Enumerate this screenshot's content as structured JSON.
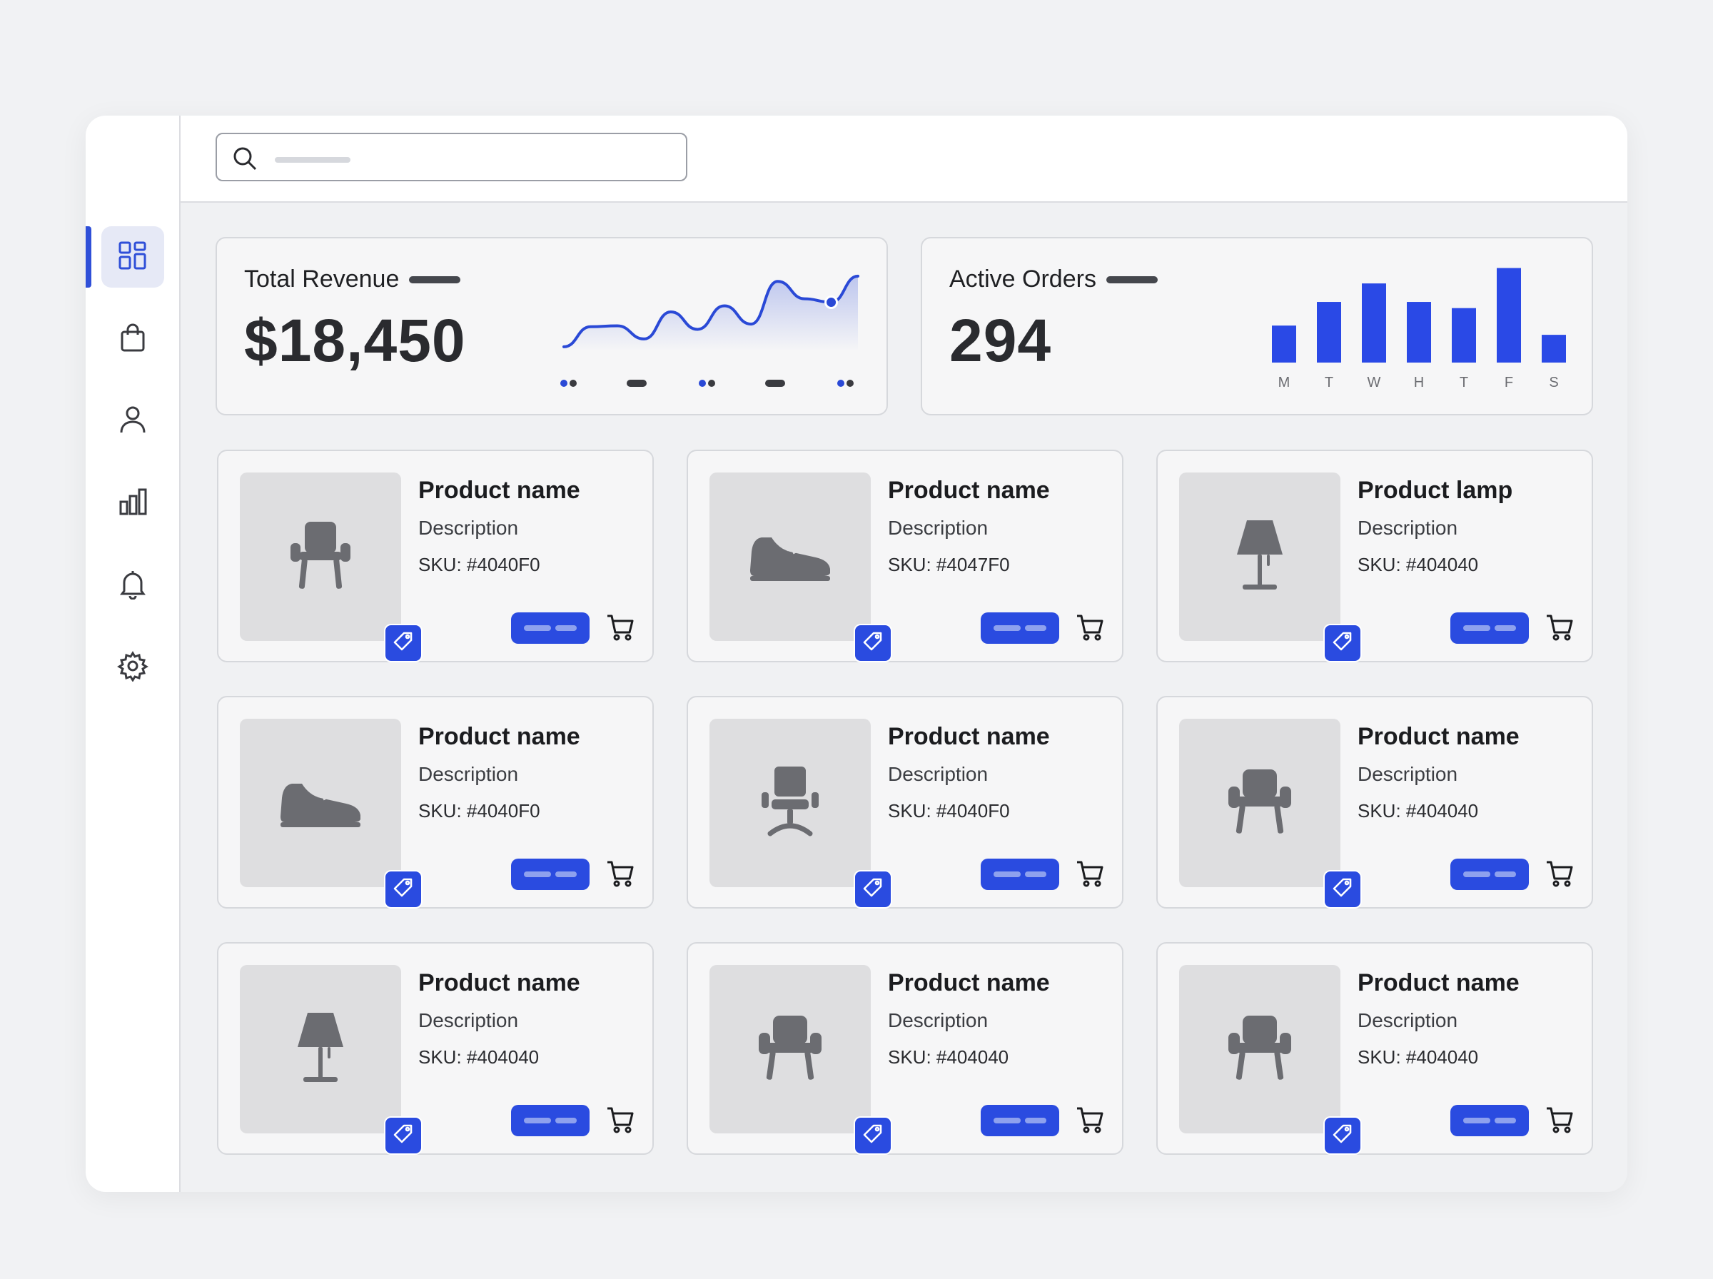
{
  "search": {
    "placeholder": ""
  },
  "sidebar": {
    "items": [
      {
        "name": "dashboard",
        "icon": "grid-icon",
        "active": true
      },
      {
        "name": "orders",
        "icon": "shopping-bag-icon",
        "active": false
      },
      {
        "name": "customers",
        "icon": "user-icon",
        "active": false
      },
      {
        "name": "analytics",
        "icon": "bar-chart-icon",
        "active": false
      },
      {
        "name": "notifications",
        "icon": "bell-icon",
        "active": false
      },
      {
        "name": "settings",
        "icon": "gear-icon",
        "active": false
      }
    ]
  },
  "stats": {
    "revenue": {
      "title": "Total Revenue",
      "value": "$18,450"
    },
    "orders": {
      "title": "Active Orders",
      "value": "294"
    }
  },
  "chart_data": [
    {
      "type": "area",
      "title": "",
      "x": [
        0,
        1,
        2,
        3,
        4,
        5,
        6,
        7,
        8,
        9,
        10,
        11
      ],
      "series": [
        {
          "values": [
            0.5,
            2.8,
            2.9,
            1.4,
            4.5,
            2.5,
            5.2,
            3.1,
            8.0,
            6.0,
            5.6,
            8.6
          ]
        }
      ],
      "highlight_index": 10,
      "xlabel": "",
      "ylabel": "",
      "grid": false,
      "legend": "none",
      "color": "#2a49d6"
    },
    {
      "type": "bar",
      "title": "",
      "categories": [
        "M",
        "T",
        "W",
        "H",
        "T",
        "F",
        "S"
      ],
      "values": [
        36,
        59,
        77,
        59,
        53,
        92,
        27
      ],
      "ylim": [
        0,
        100
      ],
      "grid": false,
      "legend": "none",
      "color": "#2a49e6"
    }
  ],
  "products": [
    {
      "name": "Product name",
      "description": "Description",
      "sku": "SKU: #4040F0",
      "icon": "chair-icon"
    },
    {
      "name": "Product name",
      "description": "Description",
      "sku": "SKU: #4047F0",
      "icon": "sneaker-icon"
    },
    {
      "name": "Product lamp",
      "description": "Description",
      "sku": "SKU: #404040",
      "icon": "lamp-icon"
    },
    {
      "name": "Product name",
      "description": "Description",
      "sku": "SKU: #4040F0",
      "icon": "sneaker-icon"
    },
    {
      "name": "Product name",
      "description": "Description",
      "sku": "SKU: #4040F0",
      "icon": "office-chair-icon"
    },
    {
      "name": "Product name",
      "description": "Description",
      "sku": "SKU: #404040",
      "icon": "armchair-icon"
    },
    {
      "name": "Product name",
      "description": "Description",
      "sku": "SKU: #404040",
      "icon": "lamp-icon"
    },
    {
      "name": "Product name",
      "description": "Description",
      "sku": "SKU: #404040",
      "icon": "armchair-icon"
    },
    {
      "name": "Product name",
      "description": "Description",
      "sku": "SKU: #404040",
      "icon": "armchair-icon"
    }
  ],
  "colors": {
    "accent": "#2a4be0",
    "icon_gray": "#6b6c71"
  }
}
